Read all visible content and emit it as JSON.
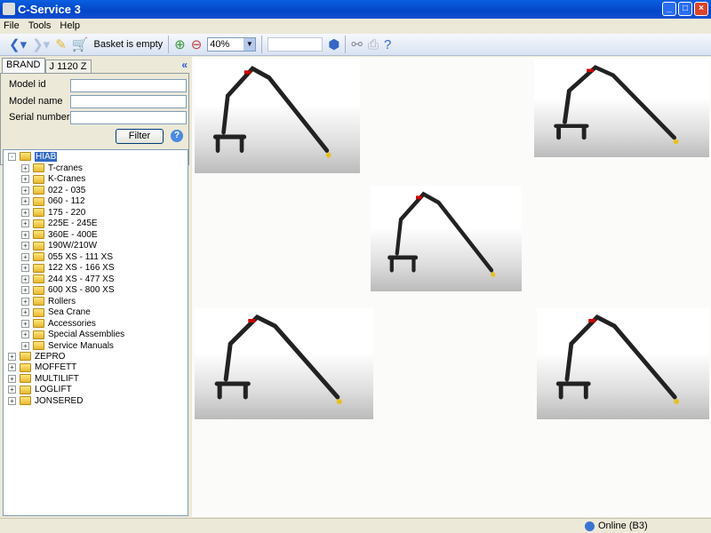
{
  "window": {
    "title": "C-Service 3"
  },
  "menu": [
    "File",
    "Tools",
    "Help"
  ],
  "toolbar": {
    "basket": "Basket is empty",
    "zoom": "40%"
  },
  "tabs": [
    "BRAND",
    "J 1120 Z"
  ],
  "form": {
    "model_id_label": "Model id",
    "model_name_label": "Model name",
    "serial_label": "Serial number",
    "filter": "Filter",
    "help": "?"
  },
  "tree": {
    "root": "HIAB",
    "children": [
      "T-cranes",
      "K-Cranes",
      "022 - 035",
      "060 - 112",
      "175 - 220",
      "225E - 245E",
      "360E - 400E",
      "190W/210W",
      "055 XS - 111 XS",
      "122 XS - 166 XS",
      "244 XS - 477 XS",
      "600 XS - 800 XS",
      "Rollers",
      "Sea Crane",
      "Accessories",
      "Special Assemblies",
      "Service Manuals"
    ],
    "others": [
      "ZEPRO",
      "MOFFETT",
      "MULTILIFT",
      "LOGLIFT",
      "JONSERED"
    ]
  },
  "status": {
    "online": "Online (B3)"
  }
}
